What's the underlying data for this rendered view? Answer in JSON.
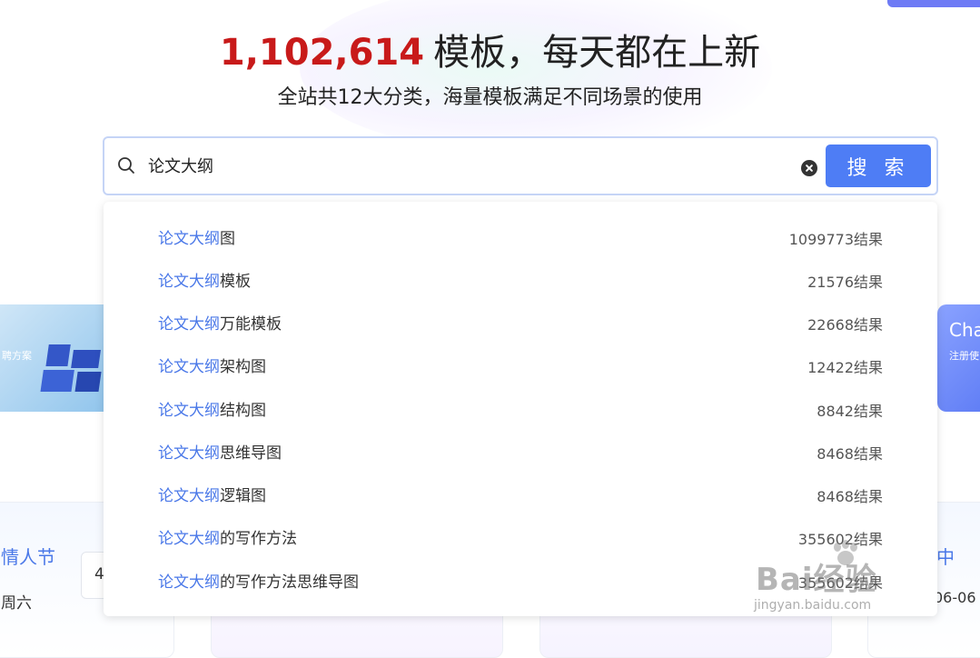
{
  "hero": {
    "count": "1,102,614",
    "title_text": "模板，每天都在上新",
    "subtitle": "全站共12大分类，海量模板满足不同场景的使用"
  },
  "search": {
    "query": "论文大纲",
    "button_label": "搜 索",
    "suggestions": [
      {
        "highlight": "论文大纲",
        "rest": "图",
        "count": "1099773结果"
      },
      {
        "highlight": "论文大纲",
        "rest": "模板",
        "count": "21576结果"
      },
      {
        "highlight": "论文大纲",
        "rest": "万能模板",
        "count": "22668结果"
      },
      {
        "highlight": "论文大纲",
        "rest": "架构图",
        "count": "12422结果"
      },
      {
        "highlight": "论文大纲",
        "rest": "结构图",
        "count": "8842结果"
      },
      {
        "highlight": "论文大纲",
        "rest": "思维导图",
        "count": "8468结果"
      },
      {
        "highlight": "论文大纲",
        "rest": "逻辑图",
        "count": "8468结果"
      },
      {
        "highlight": "论文大纲",
        "rest": "的写作方法",
        "count": "355602结果"
      },
      {
        "highlight": "论文大纲",
        "rest": "的写作方法思维导图",
        "count": "355602结果"
      }
    ]
  },
  "background": {
    "banner_left_text": "聘方案",
    "banner_right_title": "Cha",
    "banner_right_sub": "注册使",
    "card_left_title": "情人节",
    "card_left_sub": "周六",
    "card_left_box": "4",
    "card_right_title": "中",
    "card_right_sub": "06-06"
  },
  "watermark": {
    "text": "Bai经验",
    "url": "jingyan.baidu.com"
  },
  "colors": {
    "accent": "#4e7df5",
    "highlight": "#4a78e8",
    "count_red": "#c81a1a"
  }
}
